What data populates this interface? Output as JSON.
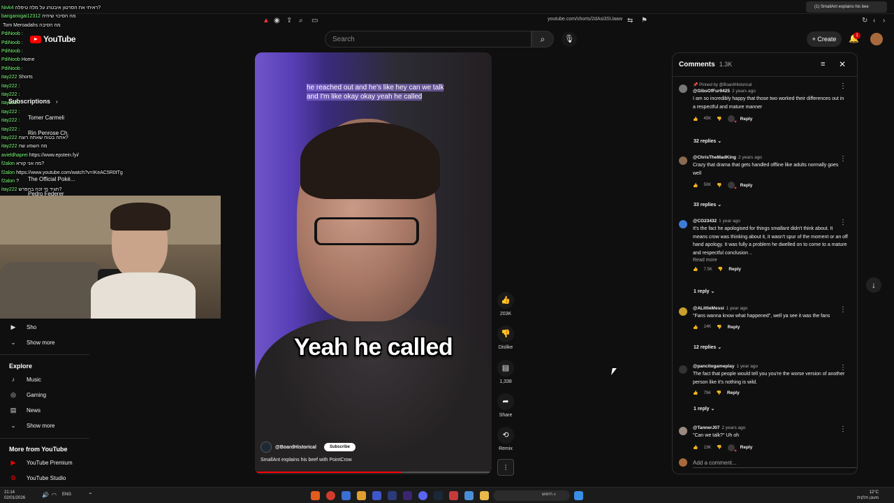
{
  "browser": {
    "tab_title": "(1) SmallAnt explains his bee",
    "url": "youtube.com/shorts/2dAsi3SUaaw"
  },
  "header": {
    "logo_text": "YouTube",
    "search_placeholder": "Search",
    "create_label": "Create",
    "notification_count": "1"
  },
  "chat": {
    "lines": [
      {
        "user": "Nivk4",
        "text": "ראיתי את הסרטון איבטרג על מלה טיפלה?"
      },
      {
        "user": "banganogai12312",
        "text": "מה הסיכוי שיהיה"
      },
      {
        "user": "",
        "text": "Tom Meroadahs מה הסיבה"
      },
      {
        "user": "PdiNoob",
        "text": ":"
      },
      {
        "user": "PdiNoob",
        "text": ":"
      },
      {
        "user": "PdiNoob",
        "text": ":"
      },
      {
        "user": "PdiNoob",
        "text": "Home"
      },
      {
        "user": "PdiNoob",
        "text": ":"
      },
      {
        "user": "itay222",
        "text": "Shorts"
      },
      {
        "user": "itay222",
        "text": ":"
      },
      {
        "user": "itay222",
        "text": ":"
      },
      {
        "user": "itay222",
        "text": ":"
      },
      {
        "user": "itay222",
        "text": ":"
      },
      {
        "user": "itay222",
        "text": ":"
      },
      {
        "user": "itay222",
        "text": ":"
      },
      {
        "user": "itay222",
        "text": "אתה בטוח שאתה רוצה?"
      },
      {
        "user": "itay222",
        "text": "מה השמע שה"
      },
      {
        "user": "avieldhaprei",
        "text": "https://www.epstein.fyi/"
      },
      {
        "user": "f2alon",
        "text": "מה אני קורא?"
      },
      {
        "user": "f2alon",
        "text": "https://www.youtube.com/watch?v=IKeAC5R0tTg"
      },
      {
        "user": "f2alon",
        "text": "?"
      },
      {
        "user": "itay222",
        "text": "תגיד מי זכה בהפרש?"
      },
      {
        "user": "itay222",
        "text": "תגיד מי זכה הבטריה בזמן ?"
      }
    ]
  },
  "sidebar": {
    "subscriptions_label": "Subscriptions",
    "subs": [
      "Tomer Carmeli",
      "Rin Penrose Ch.",
      "The Official Poké...",
      "Pedro Federer"
    ],
    "you_items": [
      {
        "label": "Sho",
        "icon": "shorts-icon"
      },
      {
        "label": "Show more",
        "icon": "chevron-down-icon"
      }
    ],
    "explore_label": "Explore",
    "explore": [
      {
        "label": "Music",
        "icon": "music-icon"
      },
      {
        "label": "Gaming",
        "icon": "gaming-icon"
      },
      {
        "label": "News",
        "icon": "news-icon"
      },
      {
        "label": "Show more",
        "icon": "chevron-down-icon"
      }
    ],
    "more_label": "More from YouTube",
    "more": [
      {
        "label": "YouTube Premium",
        "icon": "youtube-premium-icon"
      },
      {
        "label": "YouTube Studio",
        "icon": "youtube-studio-icon"
      }
    ]
  },
  "video": {
    "top_subtitle": "he reached out and he's like hey can we talk and I'm like okay okay yeah he called",
    "caption": "Yeah he called",
    "channel": "@BoardHistorical",
    "subscribe_label": "Subscribe",
    "title": "SmallAnt explains his beef with PointCrow",
    "progress": 0.62
  },
  "actions": {
    "likes": "203K",
    "dislike_label": "Dislike",
    "comments": "1,338",
    "share_label": "Share",
    "remix_label": "Remix"
  },
  "comments": {
    "title": "Comments",
    "count": "1.3K",
    "add_placeholder": "Add a comment...",
    "items": [
      {
        "pinned": "Pinned by @BoardHistorical",
        "author": "@GibsOfFur9425",
        "age": "2 years ago",
        "text": "I am so incredibly happy that those two worked their differences out in a respectful and mature manner",
        "likes": "45K",
        "reply_label": "Reply",
        "replies": "32 replies",
        "heart": true
      },
      {
        "pinned": "",
        "author": "@ChrisTheMadKing",
        "age": "2 years ago",
        "text": "Crazy that drama that gets handled offline like adults normally goes well",
        "likes": "50K",
        "reply_label": "Reply",
        "replies": "33 replies",
        "heart": true
      },
      {
        "pinned": "",
        "author": "@CO23432",
        "age": "1 year ago",
        "text": "It's the fact he apologised for things smallant didn't think about. It means crow was thinking about it, it wasn't spur of the moment or an off hand apology. It was fully a problem he dwelled on to come to a mature and respectful conclusion ..",
        "read_more": "Read more",
        "likes": "7.5K",
        "reply_label": "Reply",
        "replies": "1 reply",
        "heart": false
      },
      {
        "pinned": "",
        "author": "@ALittleMessi",
        "age": "1 year ago",
        "text": "\"Fans wanna know what happened\", well ya see it was the fans",
        "likes": "14K",
        "reply_label": "Reply",
        "replies": "12 replies",
        "heart": false
      },
      {
        "pinned": "",
        "author": "@pancitogameplay",
        "age": "1 year ago",
        "text": "The fact that people would tell you you're the worse version of another person like it's nothing is wild.",
        "likes": "794",
        "reply_label": "Reply",
        "replies": "1 reply",
        "heart": false
      },
      {
        "pinned": "",
        "author": "@TannerJ07",
        "age": "2 years ago",
        "text": "\"Can we talk?\" Uh oh",
        "likes": "13K",
        "reply_label": "Reply",
        "replies": "",
        "heart": true
      }
    ]
  },
  "taskbar": {
    "time_left": "21:14",
    "date_left": "02/01/2026",
    "lang": "ENG",
    "search_label": "חיפוש",
    "weather": "12°C",
    "weather_sub": "מעונן חלקית"
  }
}
